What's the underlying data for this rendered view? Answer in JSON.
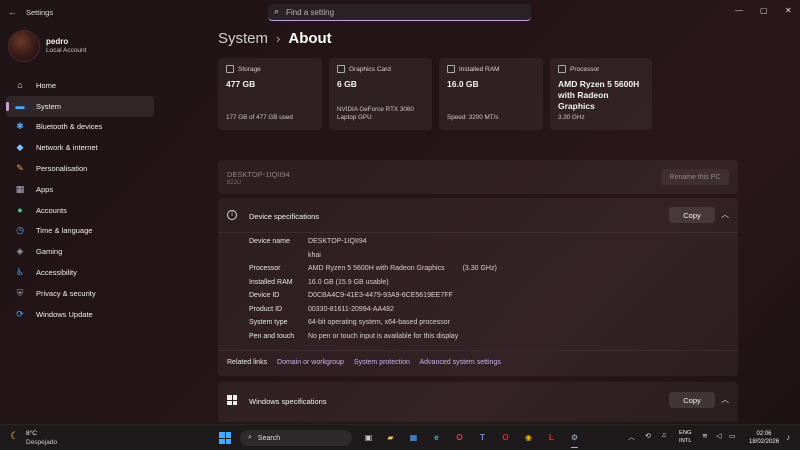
{
  "window": {
    "back_glyph": "←",
    "title": "Settings",
    "search_placeholder": "Find a setting",
    "controls": [
      "—",
      "▢",
      "✕"
    ]
  },
  "user": {
    "name": "pedro",
    "account": "Local Account"
  },
  "sidebar": {
    "items": [
      {
        "label": "Home",
        "icon": "home-icon",
        "color": "#e9e9e9"
      },
      {
        "label": "System",
        "icon": "monitor-icon",
        "color": "#4aa8ff",
        "active": true
      },
      {
        "label": "Bluetooth & devices",
        "icon": "bluetooth-icon",
        "color": "#4aa8ff"
      },
      {
        "label": "Network & internet",
        "icon": "wifi-icon",
        "color": "#7fc6ff"
      },
      {
        "label": "Personalisation",
        "icon": "brush-icon",
        "color": "#e6a36a"
      },
      {
        "label": "Apps",
        "icon": "apps-icon",
        "color": "#b0b0c8"
      },
      {
        "label": "Accounts",
        "icon": "person-icon",
        "color": "#4ec39a"
      },
      {
        "label": "Time & language",
        "icon": "clock-globe-icon",
        "color": "#5aa8e8"
      },
      {
        "label": "Gaming",
        "icon": "gamepad-icon",
        "color": "#9aa0aa"
      },
      {
        "label": "Accessibility",
        "icon": "accessibility-icon",
        "color": "#4aa8ff"
      },
      {
        "label": "Privacy & security",
        "icon": "shield-icon",
        "color": "#9aa0aa"
      },
      {
        "label": "Windows Update",
        "icon": "update-icon",
        "color": "#4aa8ff"
      }
    ]
  },
  "breadcrumb": {
    "parent": "System",
    "separator": "›",
    "current": "About"
  },
  "cards": [
    {
      "head": "Storage",
      "value": "477 GB",
      "sub": "177 GB of 477 GB used"
    },
    {
      "head": "Graphics Card",
      "value": "6 GB",
      "sub": "NVIDIA GeForce RTX 3060 Laptop GPU"
    },
    {
      "head": "Installed RAM",
      "value": "16.0 GB",
      "sub": "Speed: 3200 MT/s"
    },
    {
      "head": "Processor",
      "value": "AMD Ryzen 5 5600H with Radeon Graphics",
      "sub": "3.30 GHz"
    }
  ],
  "pc": {
    "name": "DESKTOP-1IQII94",
    "model": "82JU",
    "rename_label": "Rename this PC"
  },
  "device_specs": {
    "title": "Device specifications",
    "copy_label": "Copy",
    "rows": [
      {
        "key": "Device name",
        "value": "DESKTOP-1IQII94",
        "extra": ""
      },
      {
        "key": "",
        "value": "khai",
        "extra": ""
      },
      {
        "key": "Processor",
        "value": "AMD Ryzen 5 5600H with Radeon Graphics",
        "extra": "(3.30 GHz)"
      },
      {
        "key": "Installed RAM",
        "value": "16.0 GB (15.9 GB usable)",
        "extra": ""
      },
      {
        "key": "Device ID",
        "value": "D0CBA4C9-41E3-4479-93A9-6CE5619EE7FF",
        "extra": ""
      },
      {
        "key": "Product ID",
        "value": "00330-81611-20994-AA482",
        "extra": ""
      },
      {
        "key": "System type",
        "value": "64-bit operating system, x64-based processor",
        "extra": ""
      },
      {
        "key": "Pen and touch",
        "value": "No pen or touch input is available for this display",
        "extra": ""
      }
    ],
    "related_label": "Related links",
    "related_links": [
      "Domain or workgroup",
      "System protection",
      "Advanced system settings"
    ]
  },
  "windows_specs": {
    "title": "Windows specifications",
    "copy_label": "Copy"
  },
  "taskbar": {
    "weather_temp": "8°C",
    "weather_desc": "Despejado",
    "search_label": "Search",
    "apps": [
      {
        "name": "task-view",
        "glyph": "▣",
        "color": "#cfcfcf"
      },
      {
        "name": "file-explorer",
        "glyph": "▰",
        "color": "#f2c14e"
      },
      {
        "name": "store",
        "glyph": "▦",
        "color": "#4aa8ff"
      },
      {
        "name": "edge",
        "glyph": "e",
        "color": "#2fb3e8"
      },
      {
        "name": "opera-gx",
        "glyph": "O",
        "color": "#ff2c5a"
      },
      {
        "name": "teams",
        "glyph": "T",
        "color": "#7b83eb"
      },
      {
        "name": "opera",
        "glyph": "O",
        "color": "#ff1b2d"
      },
      {
        "name": "chrome",
        "glyph": "◉",
        "color": "#f5b400"
      },
      {
        "name": "app-l",
        "glyph": "L",
        "color": "#e0342d"
      },
      {
        "name": "settings",
        "glyph": "⚙",
        "color": "#a9b8c8"
      }
    ],
    "lang_line1": "ENG",
    "lang_line2": "INTL",
    "time": "02:06",
    "date": "18/02/2026"
  },
  "colors": {
    "accent": "#c9a3d4",
    "link": "#c9b4e6"
  }
}
